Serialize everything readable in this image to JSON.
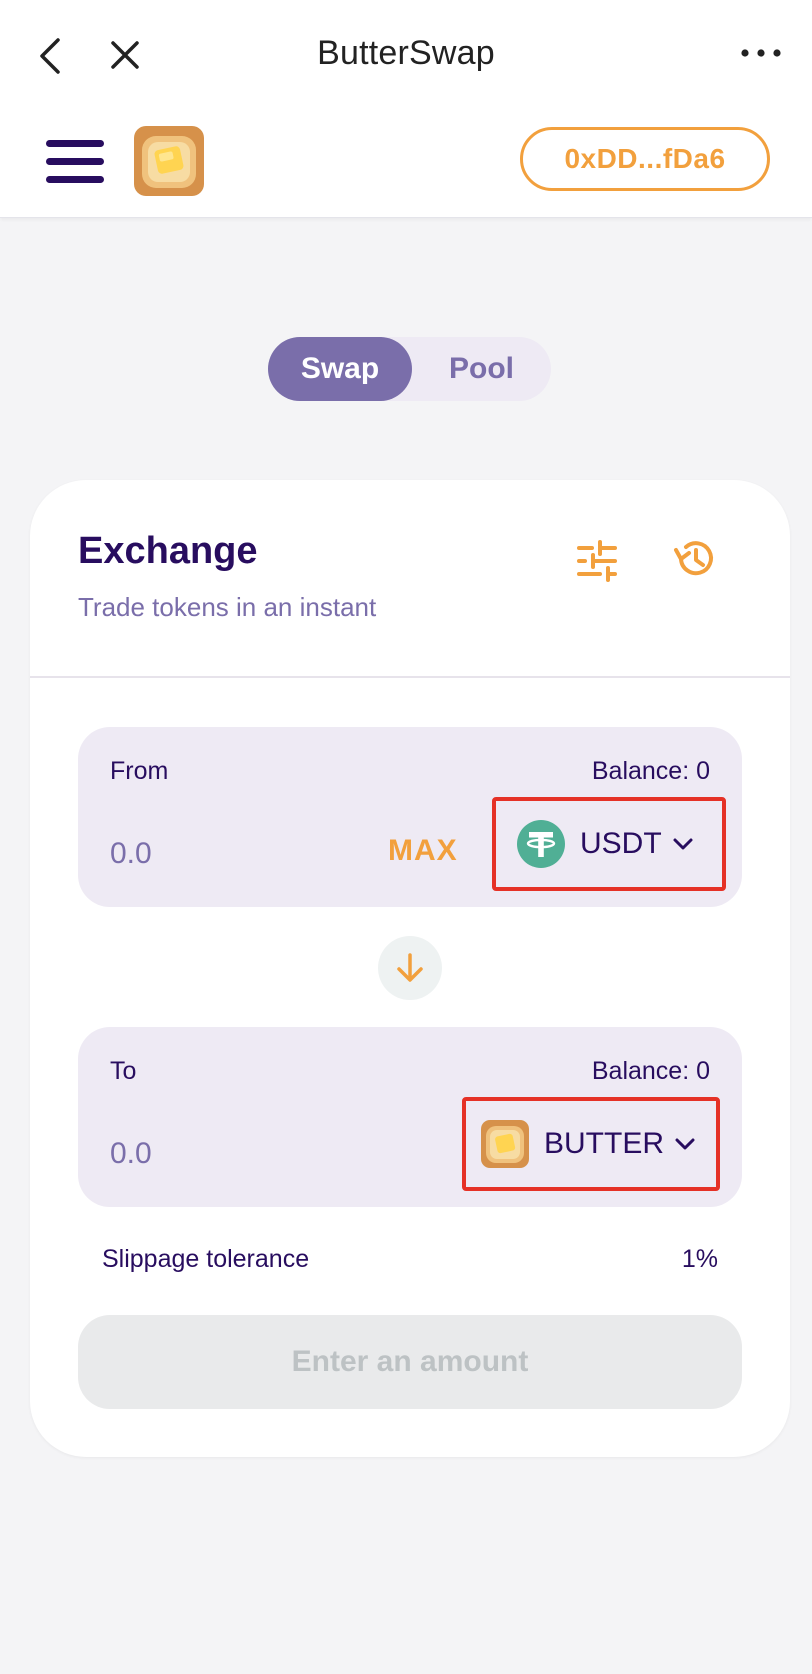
{
  "titlebar": {
    "title": "ButterSwap"
  },
  "header": {
    "wallet_address": "0xDD...fDa6"
  },
  "toggle": {
    "swap_label": "Swap",
    "pool_label": "Pool",
    "selected": "Swap"
  },
  "exchange": {
    "title": "Exchange",
    "subtitle": "Trade tokens in an instant"
  },
  "from": {
    "label": "From",
    "balance": "Balance: 0",
    "amount_placeholder": "0.0",
    "max_label": "MAX",
    "token": "USDT"
  },
  "to": {
    "label": "To",
    "balance": "Balance: 0",
    "amount_placeholder": "0.0",
    "token": "BUTTER"
  },
  "slippage": {
    "label": "Slippage tolerance",
    "value": "1%"
  },
  "submit": {
    "label": "Enter an amount"
  },
  "colors": {
    "accent": "#f2a03d",
    "primary_text": "#280d5f",
    "secondary": "#7a6eaa",
    "highlight_box": "#e53126"
  },
  "icons": [
    "back-icon",
    "close-icon",
    "more-icon",
    "menu-icon",
    "butter-logo",
    "settings-icon",
    "history-icon",
    "usdt-icon",
    "butter-token-icon",
    "chevron-down-icon",
    "arrow-down-icon"
  ]
}
